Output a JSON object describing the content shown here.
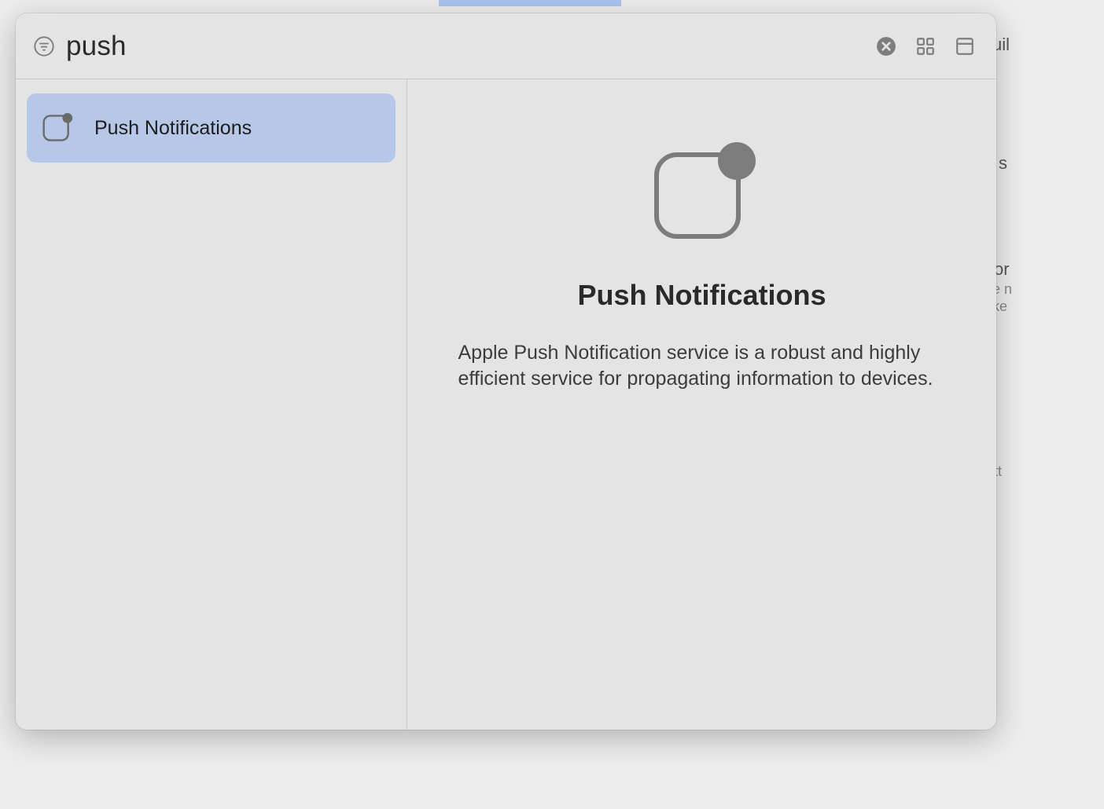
{
  "header": {
    "search_value": "push"
  },
  "sidebar": {
    "items": [
      {
        "label": "Push Notifications",
        "selected": true
      }
    ]
  },
  "detail": {
    "title": "Push Notifications",
    "description": "Apple Push Notification service is a robust and highly efficient service for propagating information to devices."
  },
  "background_fragments": {
    "f0": "uil",
    "f1": "s",
    "f2": "or",
    "f3": "e n",
    "f4": "ke",
    "f5": "tt"
  }
}
